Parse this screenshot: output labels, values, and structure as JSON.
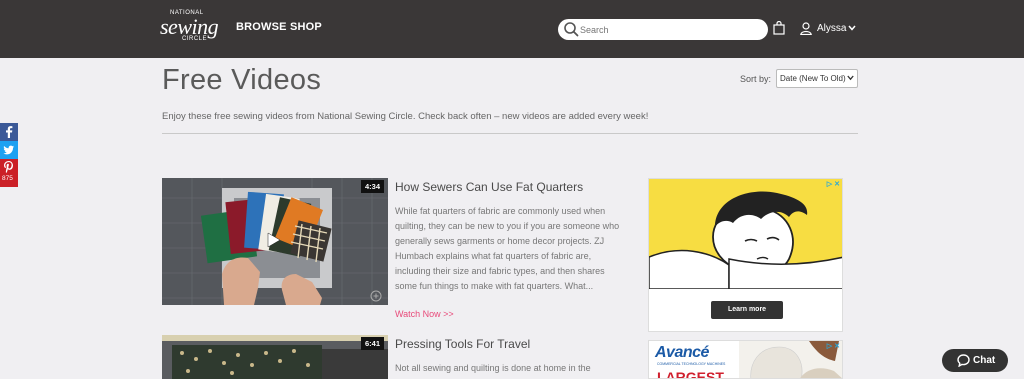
{
  "header": {
    "logo_line1": "NATIONAL",
    "logo_line2": "sewing",
    "logo_line3": "CIRCLE",
    "nav": [
      "BROWSE",
      "SHOP"
    ],
    "search_placeholder": "Search",
    "user_name": "Alyssa"
  },
  "social": {
    "pinterest_count": "875"
  },
  "page": {
    "title": "Free Videos",
    "sort_label": "Sort by:",
    "sort_value": "Date (New To Old)",
    "intro": "Enjoy these free sewing videos from National Sewing Circle. Check back often – new videos are added every week!"
  },
  "videos": [
    {
      "duration": "4:34",
      "title": "How Sewers Can Use Fat Quarters",
      "description": "While fat quarters of fabric are commonly used when quilting, they can be new to you if you are someone who generally sews garments or home decor projects. ZJ Humbach explains what fat quarters of fabric are, including their size and fabric types, and then shares some fun things to make with fat quarters. What...",
      "watch_label": "Watch Now >>"
    },
    {
      "duration": "6:41",
      "title": "Pressing Tools For Travel",
      "description": "Not all sewing and quilting is done at home in the"
    }
  ],
  "ads": {
    "ad1_button": "Learn more",
    "ad2_brand": "Avancé",
    "ad2_sub": "COMMERCIAL TECHNOLOGY MACHINES",
    "ad2_headline": "LARGEST"
  },
  "chat_label": "Chat",
  "colors": {
    "header_bg": "#3a3737",
    "page_bg": "#f0eff2",
    "link_pink": "#e84a7a",
    "facebook": "#3b5998",
    "twitter": "#1da1f2",
    "pinterest": "#cb2027"
  }
}
